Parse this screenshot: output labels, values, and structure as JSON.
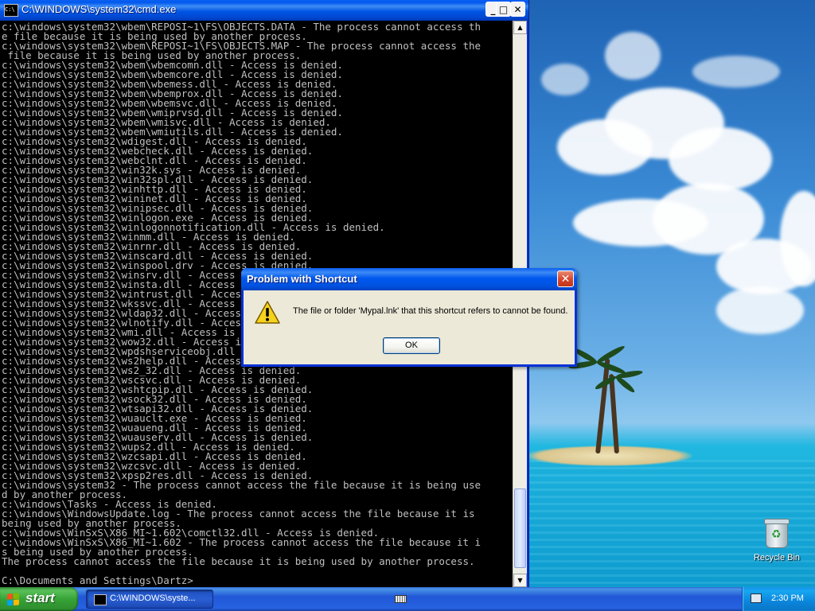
{
  "console_window": {
    "title": "C:\\WINDOWS\\system32\\cmd.exe",
    "icon": "console-icon",
    "controls": {
      "minimize": "_",
      "maximize": "□",
      "close": "✕"
    },
    "output_lines": [
      "c:\\windows\\system32\\wbem\\REPOSI~1\\FS\\OBJECTS.DATA - The process cannot access th",
      "e file because it is being used by another process.",
      "c:\\windows\\system32\\wbem\\REPOSI~1\\FS\\OBJECTS.MAP - The process cannot access the",
      " file because it is being used by another process.",
      "c:\\windows\\system32\\wbem\\wbemcomn.dll - Access is denied.",
      "c:\\windows\\system32\\wbem\\wbemcore.dll - Access is denied.",
      "c:\\windows\\system32\\wbem\\wbemess.dll - Access is denied.",
      "c:\\windows\\system32\\wbem\\wbemprox.dll - Access is denied.",
      "c:\\windows\\system32\\wbem\\wbemsvc.dll - Access is denied.",
      "c:\\windows\\system32\\wbem\\wmiprvsd.dll - Access is denied.",
      "c:\\windows\\system32\\wbem\\wmisvc.dll - Access is denied.",
      "c:\\windows\\system32\\wbem\\wmiutils.dll - Access is denied.",
      "c:\\windows\\system32\\wdigest.dll - Access is denied.",
      "c:\\windows\\system32\\webcheck.dll - Access is denied.",
      "c:\\windows\\system32\\webclnt.dll - Access is denied.",
      "c:\\windows\\system32\\win32k.sys - Access is denied.",
      "c:\\windows\\system32\\win32spl.dll - Access is denied.",
      "c:\\windows\\system32\\winhttp.dll - Access is denied.",
      "c:\\windows\\system32\\wininet.dll - Access is denied.",
      "c:\\windows\\system32\\winipsec.dll - Access is denied.",
      "c:\\windows\\system32\\winlogon.exe - Access is denied.",
      "c:\\windows\\system32\\winlogonnotification.dll - Access is denied.",
      "c:\\windows\\system32\\winmm.dll - Access is denied.",
      "c:\\windows\\system32\\winrnr.dll - Access is denied.",
      "c:\\windows\\system32\\winscard.dll - Access is denied.",
      "c:\\windows\\system32\\winspool.drv - Access is denied.",
      "c:\\windows\\system32\\winsrv.dll - Access is denied.",
      "c:\\windows\\system32\\winsta.dll - Access is denied.",
      "c:\\windows\\system32\\wintrust.dll - Access is denied.",
      "c:\\windows\\system32\\wkssvc.dll - Access is denied.",
      "c:\\windows\\system32\\wldap32.dll - Access is denied.",
      "c:\\windows\\system32\\wlnotify.dll - Access is denied.",
      "c:\\windows\\system32\\wmi.dll - Access is denied.",
      "c:\\windows\\system32\\wow32.dll - Access is denied.",
      "c:\\windows\\system32\\wpdshserviceobj.dll - Access is denied.",
      "c:\\windows\\system32\\ws2help.dll - Access is denied.",
      "c:\\windows\\system32\\ws2_32.dll - Access is denied.",
      "c:\\windows\\system32\\wscsvc.dll - Access is denied.",
      "c:\\windows\\system32\\wshtcpip.dll - Access is denied.",
      "c:\\windows\\system32\\wsock32.dll - Access is denied.",
      "c:\\windows\\system32\\wtsapi32.dll - Access is denied.",
      "c:\\windows\\system32\\wuauclt.exe - Access is denied.",
      "c:\\windows\\system32\\wuaueng.dll - Access is denied.",
      "c:\\windows\\system32\\wuauserv.dll - Access is denied.",
      "c:\\windows\\system32\\wups2.dll - Access is denied.",
      "c:\\windows\\system32\\wzcsapi.dll - Access is denied.",
      "c:\\windows\\system32\\wzcsvc.dll - Access is denied.",
      "c:\\windows\\system32\\xpsp2res.dll - Access is denied.",
      "c:\\windows\\system32 - The process cannot access the file because it is being use",
      "d by another process.",
      "c:\\windows\\Tasks - Access is denied.",
      "c:\\windows\\WindowsUpdate.log - The process cannot access the file because it is",
      "being used by another process.",
      "c:\\windows\\WinSxS\\X86_MI~1.602\\comctl32.dll - Access is denied.",
      "c:\\windows\\WinSxS\\X86_MI~1.602 - The process cannot access the file because it i",
      "s being used by another process.",
      "The process cannot access the file because it is being used by another process.",
      "",
      "C:\\Documents and Settings\\Dartz>"
    ],
    "scrollbar": {
      "up": "▲",
      "down": "▼"
    }
  },
  "dialog": {
    "title": "Problem with Shortcut",
    "close": "✕",
    "icon": "warning-icon",
    "message": "The file or folder 'Mypal.lnk' that this shortcut refers to cannot be found.",
    "ok_label": "OK"
  },
  "desktop": {
    "recycle_bin_label": "Recycle Bin"
  },
  "taskbar": {
    "start_label": "start",
    "task_label": "C:\\WINDOWS\\syste...",
    "clock": "2:30 PM"
  }
}
